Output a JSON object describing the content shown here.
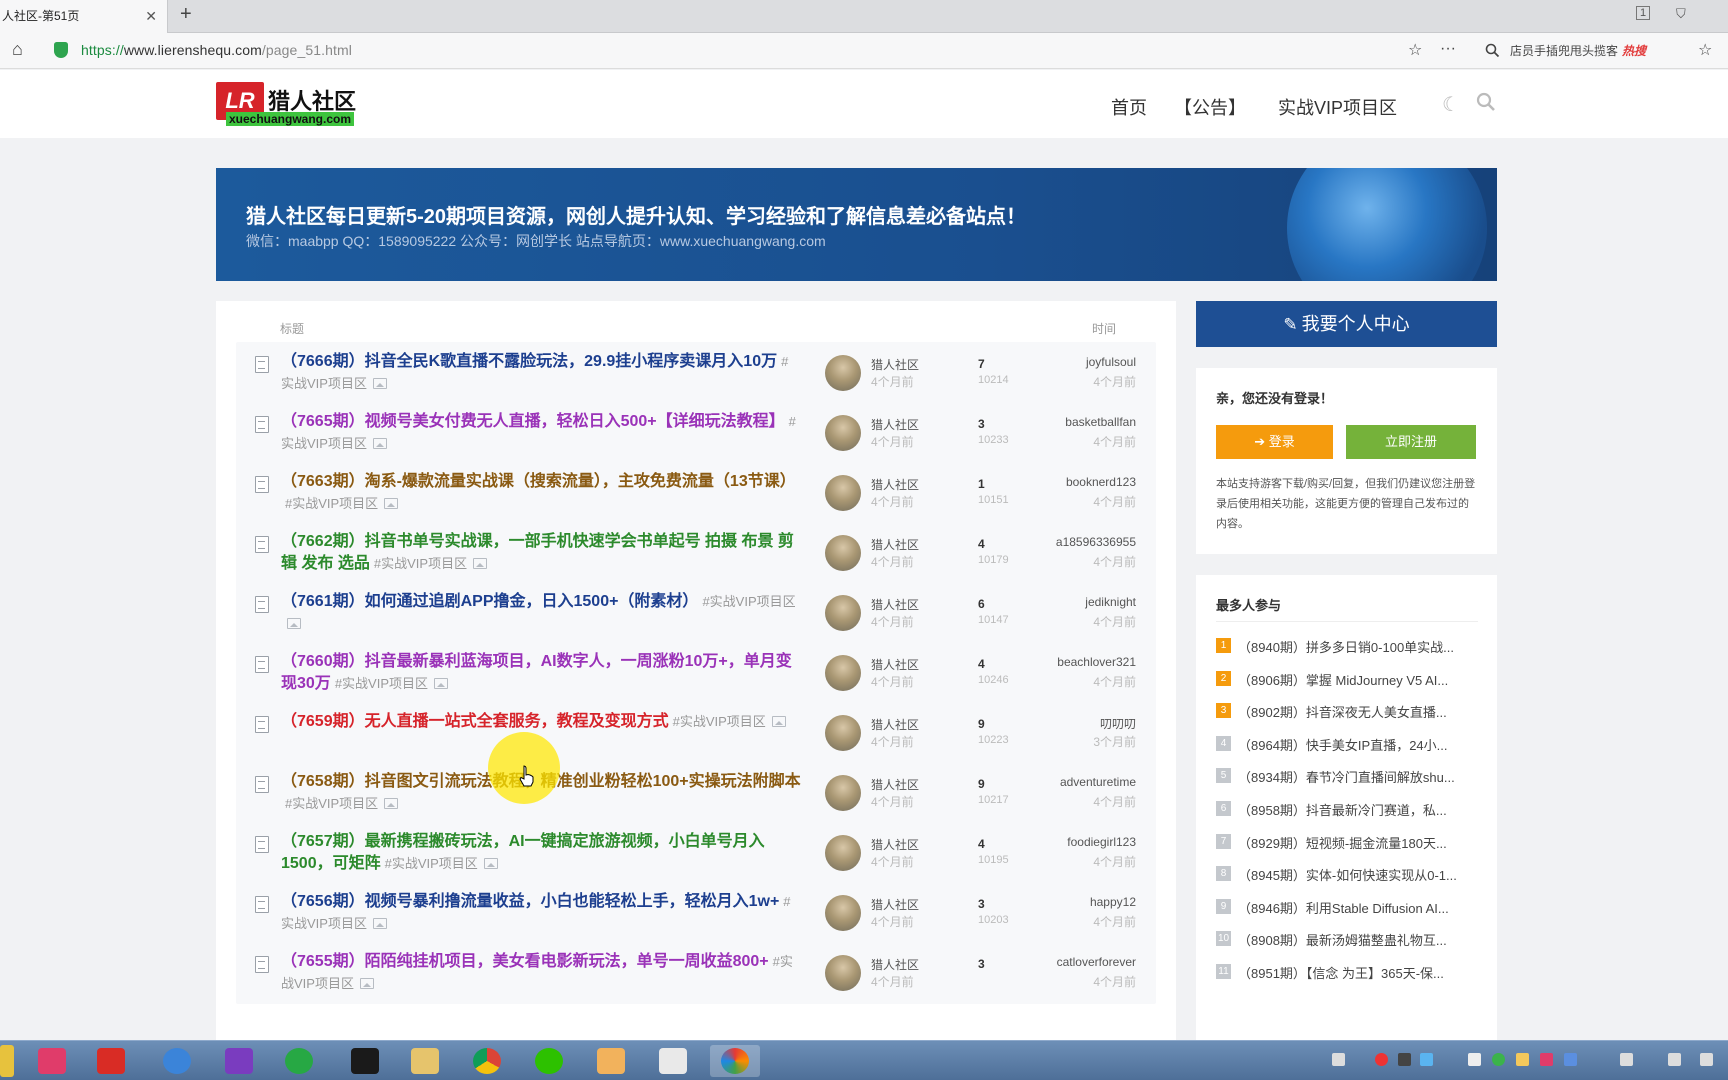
{
  "browser": {
    "tab_title": "人社区-第51页",
    "tab_close": "✕",
    "new_tab": "+",
    "url_scheme": "https://",
    "url_host": "www.lierenshequ.com",
    "url_path": "/page_51.html",
    "search_hint": "店员手插兜甩头揽客",
    "search_hot": "热搜",
    "win_badge": "1"
  },
  "site": {
    "logo_mark": "LR",
    "logo_text": "猎人社区",
    "logo_sub": "xuechuangwang.com",
    "nav": [
      "首页",
      "【公告】",
      "实战VIP项目区"
    ]
  },
  "banner": {
    "title": "猎人社区每日更新5-20期项目资源，网创人提升认知、学习经验和了解信息差必备站点！",
    "subtitle": "微信：maabpp QQ：1589095222 公众号：网创学长 站点导航页：www.xuechuangwang.com"
  },
  "list": {
    "header_title": "标题",
    "header_time": "时间",
    "rows": [
      {
        "title": "（7666期）抖音全民K歌直播不露脸玩法，29.9挂小程序卖课月入10万",
        "category": "#实战VIP项目区",
        "color": "#1d3f8f",
        "author": "猎人社区",
        "author_time": "4个月前",
        "replies": "7",
        "views": "10214",
        "last_user": "joyfulsoul",
        "last_time": "4个月前"
      },
      {
        "title": "（7665期）视频号美女付费无人直播，轻松日入500+【详细玩法教程】",
        "category": "#实战VIP项目区",
        "color": "#9a32b8",
        "author": "猎人社区",
        "author_time": "4个月前",
        "replies": "3",
        "views": "10233",
        "last_user": "basketballfan",
        "last_time": "4个月前"
      },
      {
        "title": "（7663期）淘系-爆款流量实战课（搜索流量），主攻免费流量（13节课）",
        "category": "#实战VIP项目区",
        "color": "#8a5a12",
        "author": "猎人社区",
        "author_time": "4个月前",
        "replies": "1",
        "views": "10151",
        "last_user": "booknerd123",
        "last_time": "4个月前"
      },
      {
        "title": "（7662期）抖音书单号实战课，一部手机快速学会书单起号 拍摄 布景 剪辑 发布 选品",
        "category": "#实战VIP项目区",
        "color": "#2c8a2c",
        "author": "猎人社区",
        "author_time": "4个月前",
        "replies": "4",
        "views": "10179",
        "last_user": "a18596336955",
        "last_time": "4个月前"
      },
      {
        "title": "（7661期）如何通过追剧APP撸金，日入1500+（附素材）",
        "category": "#实战VIP项目区",
        "color": "#1d3f8f",
        "author": "猎人社区",
        "author_time": "4个月前",
        "replies": "6",
        "views": "10147",
        "last_user": "jediknight",
        "last_time": "4个月前"
      },
      {
        "title": "（7660期）抖音最新暴利蓝海项目，AI数字人，一周涨粉10万+，单月变现30万",
        "category": "#实战VIP项目区",
        "color": "#9a32b8",
        "author": "猎人社区",
        "author_time": "4个月前",
        "replies": "4",
        "views": "10246",
        "last_user": "beachlover321",
        "last_time": "4个月前"
      },
      {
        "title": "（7659期）无人直播一站式全套服务，教程及变现方式",
        "category": "#实战VIP项目区",
        "color": "#d6232a",
        "author": "猎人社区",
        "author_time": "4个月前",
        "replies": "9",
        "views": "10223",
        "last_user": "叨叨叨",
        "last_time": "3个月前"
      },
      {
        "title": "（7658期）抖音图文引流玩法教程，精准创业粉轻松100+实操玩法附脚本",
        "category": "#实战VIP项目区",
        "color": "#8a5a12",
        "author": "猎人社区",
        "author_time": "4个月前",
        "replies": "9",
        "views": "10217",
        "last_user": "adventuretime",
        "last_time": "4个月前"
      },
      {
        "title": "（7657期）最新携程搬砖玩法，AI一键搞定旅游视频，小白单号月入1500，可矩阵",
        "category": "#实战VIP项目区",
        "color": "#2c8a2c",
        "author": "猎人社区",
        "author_time": "4个月前",
        "replies": "4",
        "views": "10195",
        "last_user": "foodiegirl123",
        "last_time": "4个月前"
      },
      {
        "title": "（7656期）视频号暴利撸流量收益，小白也能轻松上手，轻松月入1w+",
        "category": "#实战VIP项目区",
        "color": "#1d3f8f",
        "author": "猎人社区",
        "author_time": "4个月前",
        "replies": "3",
        "views": "10203",
        "last_user": "happy12",
        "last_time": "4个月前"
      },
      {
        "title": "（7655期）陌陌纯挂机项目，美女看电影新玩法，单号一周收益800+",
        "category": "#实战VIP项目区",
        "color": "#9a32b8",
        "author": "猎人社区",
        "author_time": "4个月前",
        "replies": "3",
        "views": "",
        "last_user": "catloverforever",
        "last_time": "4个月前"
      }
    ]
  },
  "sidebar": {
    "user_center": "我要个人中心",
    "greet": "亲，您还没有登录！",
    "login": "登录",
    "register": "立即注册",
    "note": "本站支持游客下载/购买/回复，但我们仍建议您注册登录后使用相关功能，这能更方便的管理自己发布过的内容。",
    "hot_title": "最多人参与",
    "hot_items": [
      {
        "num": "1",
        "text": "（8940期）拼多多日销0-100单实战..."
      },
      {
        "num": "2",
        "text": "（8906期）掌握 MidJourney V5 AI..."
      },
      {
        "num": "3",
        "text": "（8902期）抖音深夜无人美女直播..."
      },
      {
        "num": "4",
        "text": "（8964期）快手美女IP直播，24小..."
      },
      {
        "num": "5",
        "text": "（8934期）春节冷门直播间解放shu..."
      },
      {
        "num": "6",
        "text": "（8958期）抖音最新冷门赛道，私..."
      },
      {
        "num": "7",
        "text": "（8929期）短视频-掘金流量180天..."
      },
      {
        "num": "8",
        "text": "（8945期）实体-如何快速实现从0-1..."
      },
      {
        "num": "9",
        "text": "（8946期）利用Stable Diffusion AI..."
      },
      {
        "num": "10",
        "text": "（8908期）最新汤姆猫整蛊礼物互..."
      },
      {
        "num": "11",
        "text": "（8951期）【信念 为王】365天-保..."
      }
    ]
  },
  "colors": {
    "navy": "#1d3f8f",
    "purple": "#9a32b8",
    "brown": "#8a5a12",
    "green": "#2c8a2c",
    "red": "#d6232a",
    "hot_top": "#f59b0d",
    "hot_rest": "#c4c8cd"
  }
}
